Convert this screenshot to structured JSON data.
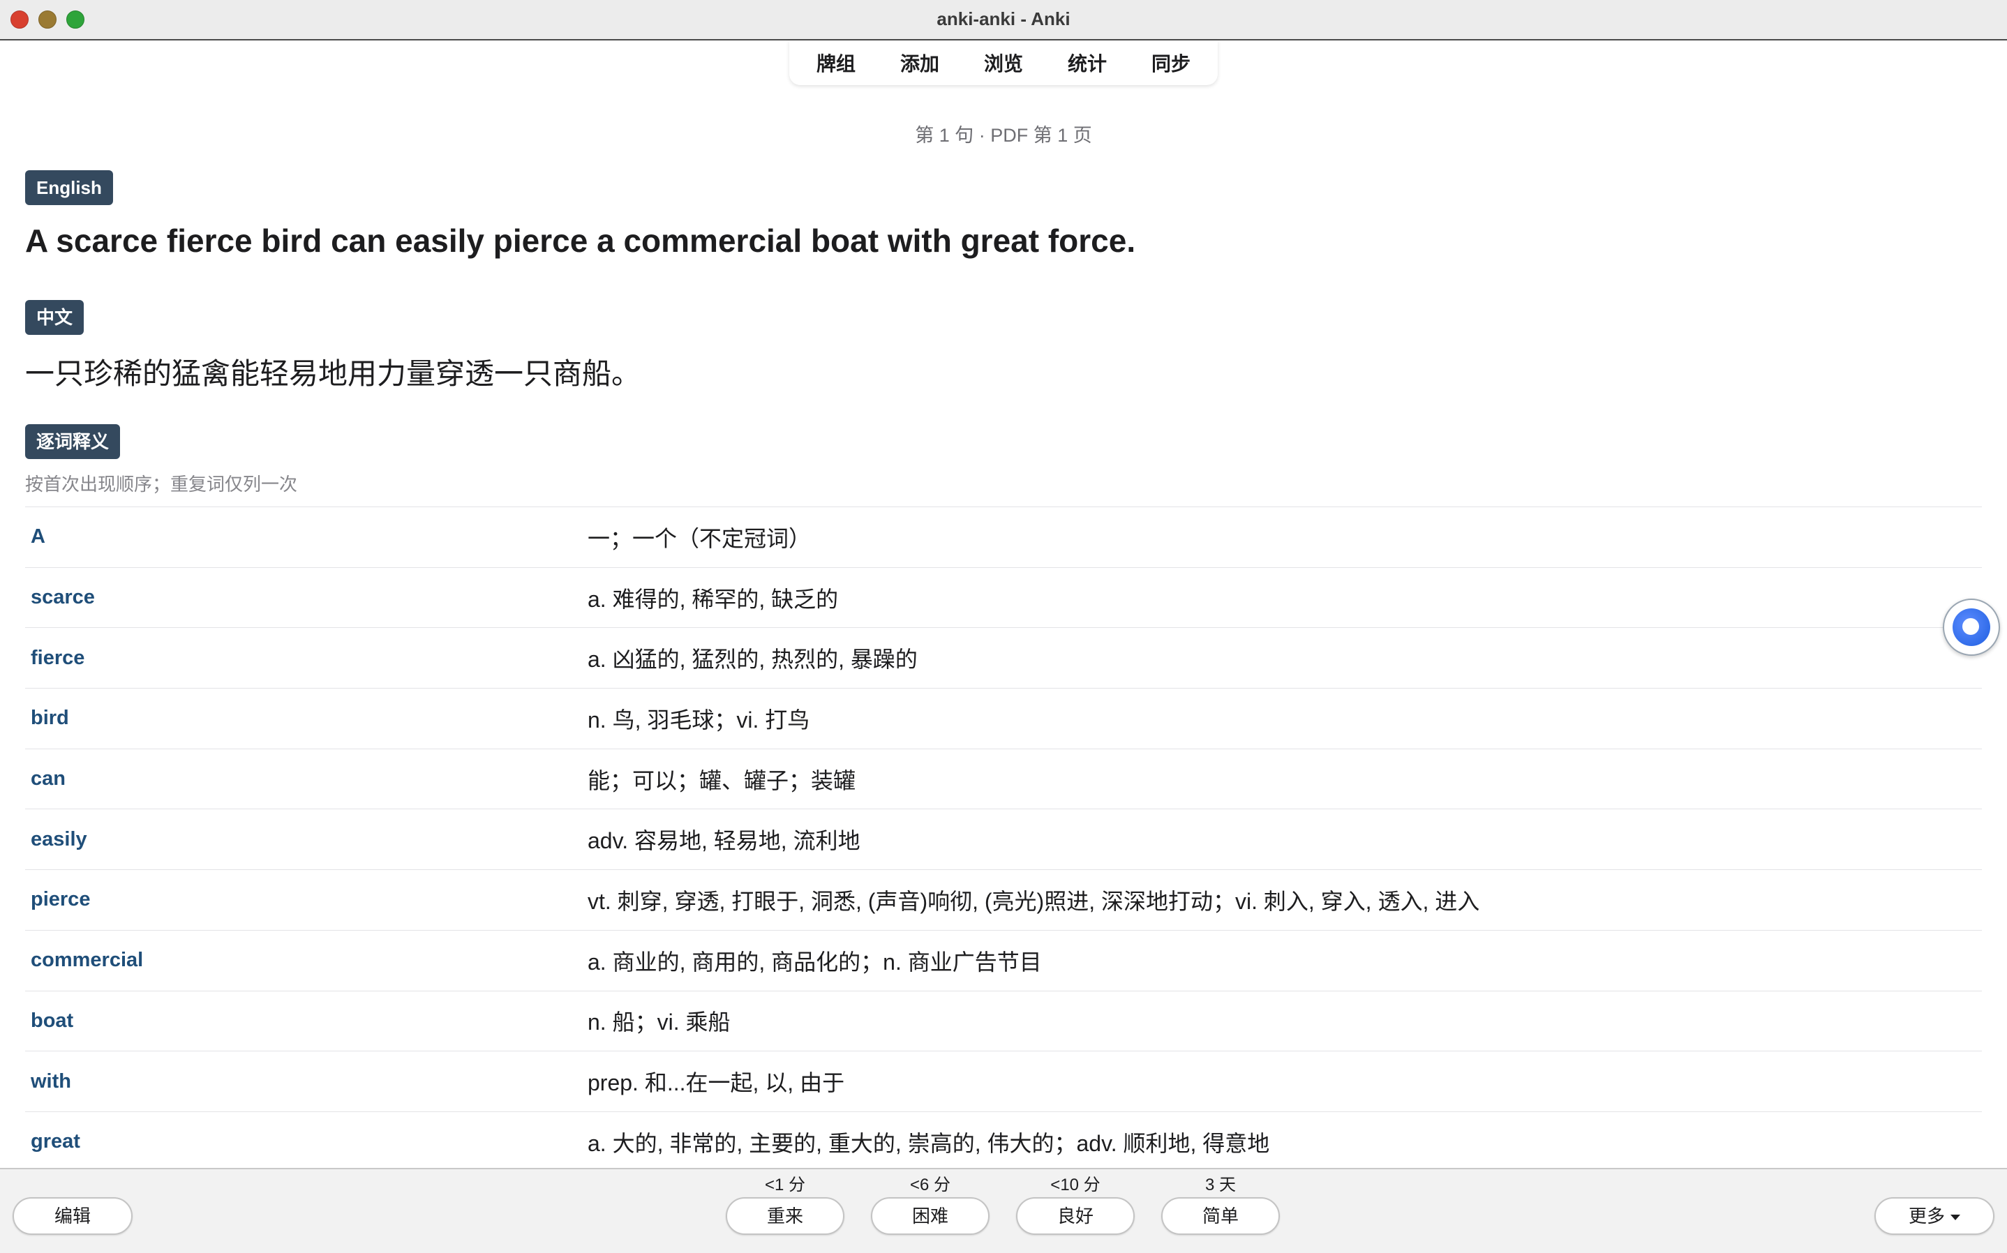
{
  "window": {
    "title": "anki-anki - Anki"
  },
  "nav": {
    "items": [
      "牌组",
      "添加",
      "浏览",
      "统计",
      "同步"
    ]
  },
  "card": {
    "position_label": "第 1 句 · PDF 第 1 页",
    "english_tag": "English",
    "english_sentence": "A scarce fierce bird can easily pierce a commercial boat with great force.",
    "chinese_tag": "中文",
    "chinese_sentence": "一只珍稀的猛禽能轻易地用力量穿透一只商船。",
    "gloss_tag": "逐词释义",
    "gloss_note": "按首次出现顺序；重复词仅列一次",
    "words": [
      {
        "word": "A",
        "meaning": "一；一个（不定冠词）"
      },
      {
        "word": "scarce",
        "meaning": "a. 难得的, 稀罕的, 缺乏的"
      },
      {
        "word": "fierce",
        "meaning": "a. 凶猛的, 猛烈的, 热烈的, 暴躁的"
      },
      {
        "word": "bird",
        "meaning": "n. 鸟, 羽毛球；vi. 打鸟"
      },
      {
        "word": "can",
        "meaning": "能；可以；罐、罐子；装罐"
      },
      {
        "word": "easily",
        "meaning": "adv. 容易地, 轻易地, 流利地"
      },
      {
        "word": "pierce",
        "meaning": "vt. 刺穿, 穿透, 打眼于, 洞悉, (声音)响彻, (亮光)照进, 深深地打动；vi. 刺入, 穿入, 透入, 进入"
      },
      {
        "word": "commercial",
        "meaning": "a. 商业的, 商用的, 商品化的；n. 商业广告节目"
      },
      {
        "word": "boat",
        "meaning": "n. 船；vi. 乘船"
      },
      {
        "word": "with",
        "meaning": "prep. 和...在一起, 以, 由于"
      },
      {
        "word": "great",
        "meaning": "a. 大的, 非常的, 主要的, 重大的, 崇高的, 伟大的；adv. 顺利地, 得意地"
      }
    ]
  },
  "bottom": {
    "edit_label": "编辑",
    "more_label": "更多",
    "answers": [
      {
        "label": "重来",
        "interval": "<1 分"
      },
      {
        "label": "困难",
        "interval": "<6 分"
      },
      {
        "label": "良好",
        "interval": "<10 分"
      },
      {
        "label": "简单",
        "interval": "3 天"
      }
    ]
  },
  "colors": {
    "tag_bg": "#34495e",
    "word_color": "#1f4e79",
    "close": "#d8402f",
    "minimize": "#9a7a33",
    "zoom": "#2ea43a"
  }
}
